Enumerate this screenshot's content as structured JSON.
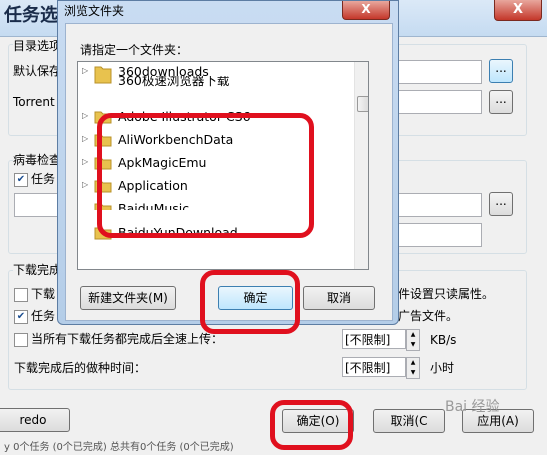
{
  "app_window": {
    "title": "任务选",
    "close_glyph": "X",
    "directory_group": {
      "label": "目录选项",
      "default_save_label": "默认保存",
      "torrent_label": "Torrent",
      "browse_glyph": "..."
    },
    "virus_group": {
      "label": "病毒检查",
      "task_checkbox_label": "任务",
      "browse_glyph": "..."
    },
    "download_complete_group": {
      "label": "下载完成",
      "row1_label_left": "下载",
      "row1_label_right": "件设置只读属性。",
      "row2_label_left": "任务",
      "row2_label_right": "广告文件。",
      "upload_label": "当所有下载任务都完成后全速上传：",
      "upload_value": "[不限制]",
      "upload_unit": "KB/s",
      "after_label": "下载完成后的做种时间：",
      "after_value": "[不限制]",
      "after_unit": "小时"
    },
    "buttons": {
      "redo": "redo",
      "ok": "确定(O)",
      "cancel": "取消(C",
      "apply": "应用(A)"
    },
    "status_text": "y 0个任务 (0个已完成)   总共有0个任务 (0个已完成)",
    "watermark": "Bai 经验"
  },
  "browse_dialog": {
    "title": "浏览文件夹",
    "close_glyph": "X",
    "prompt": "请指定一个文件夹：",
    "folders": [
      {
        "name": "360downloads"
      },
      {
        "name": "360极速浏览器下载"
      },
      {
        "name": "Adobe Illustrator CS6"
      },
      {
        "name": "AliWorkbenchData"
      },
      {
        "name": "ApkMagicEmu"
      },
      {
        "name": "Application"
      },
      {
        "name": "BaiduMusic"
      },
      {
        "name": "BaiduYunDownload"
      }
    ],
    "buttons": {
      "new_folder": "新建文件夹(M)",
      "ok": "确定",
      "cancel": "取消"
    }
  },
  "colors": {
    "highlight": "#e0101e",
    "folder": "#e8c24e"
  }
}
